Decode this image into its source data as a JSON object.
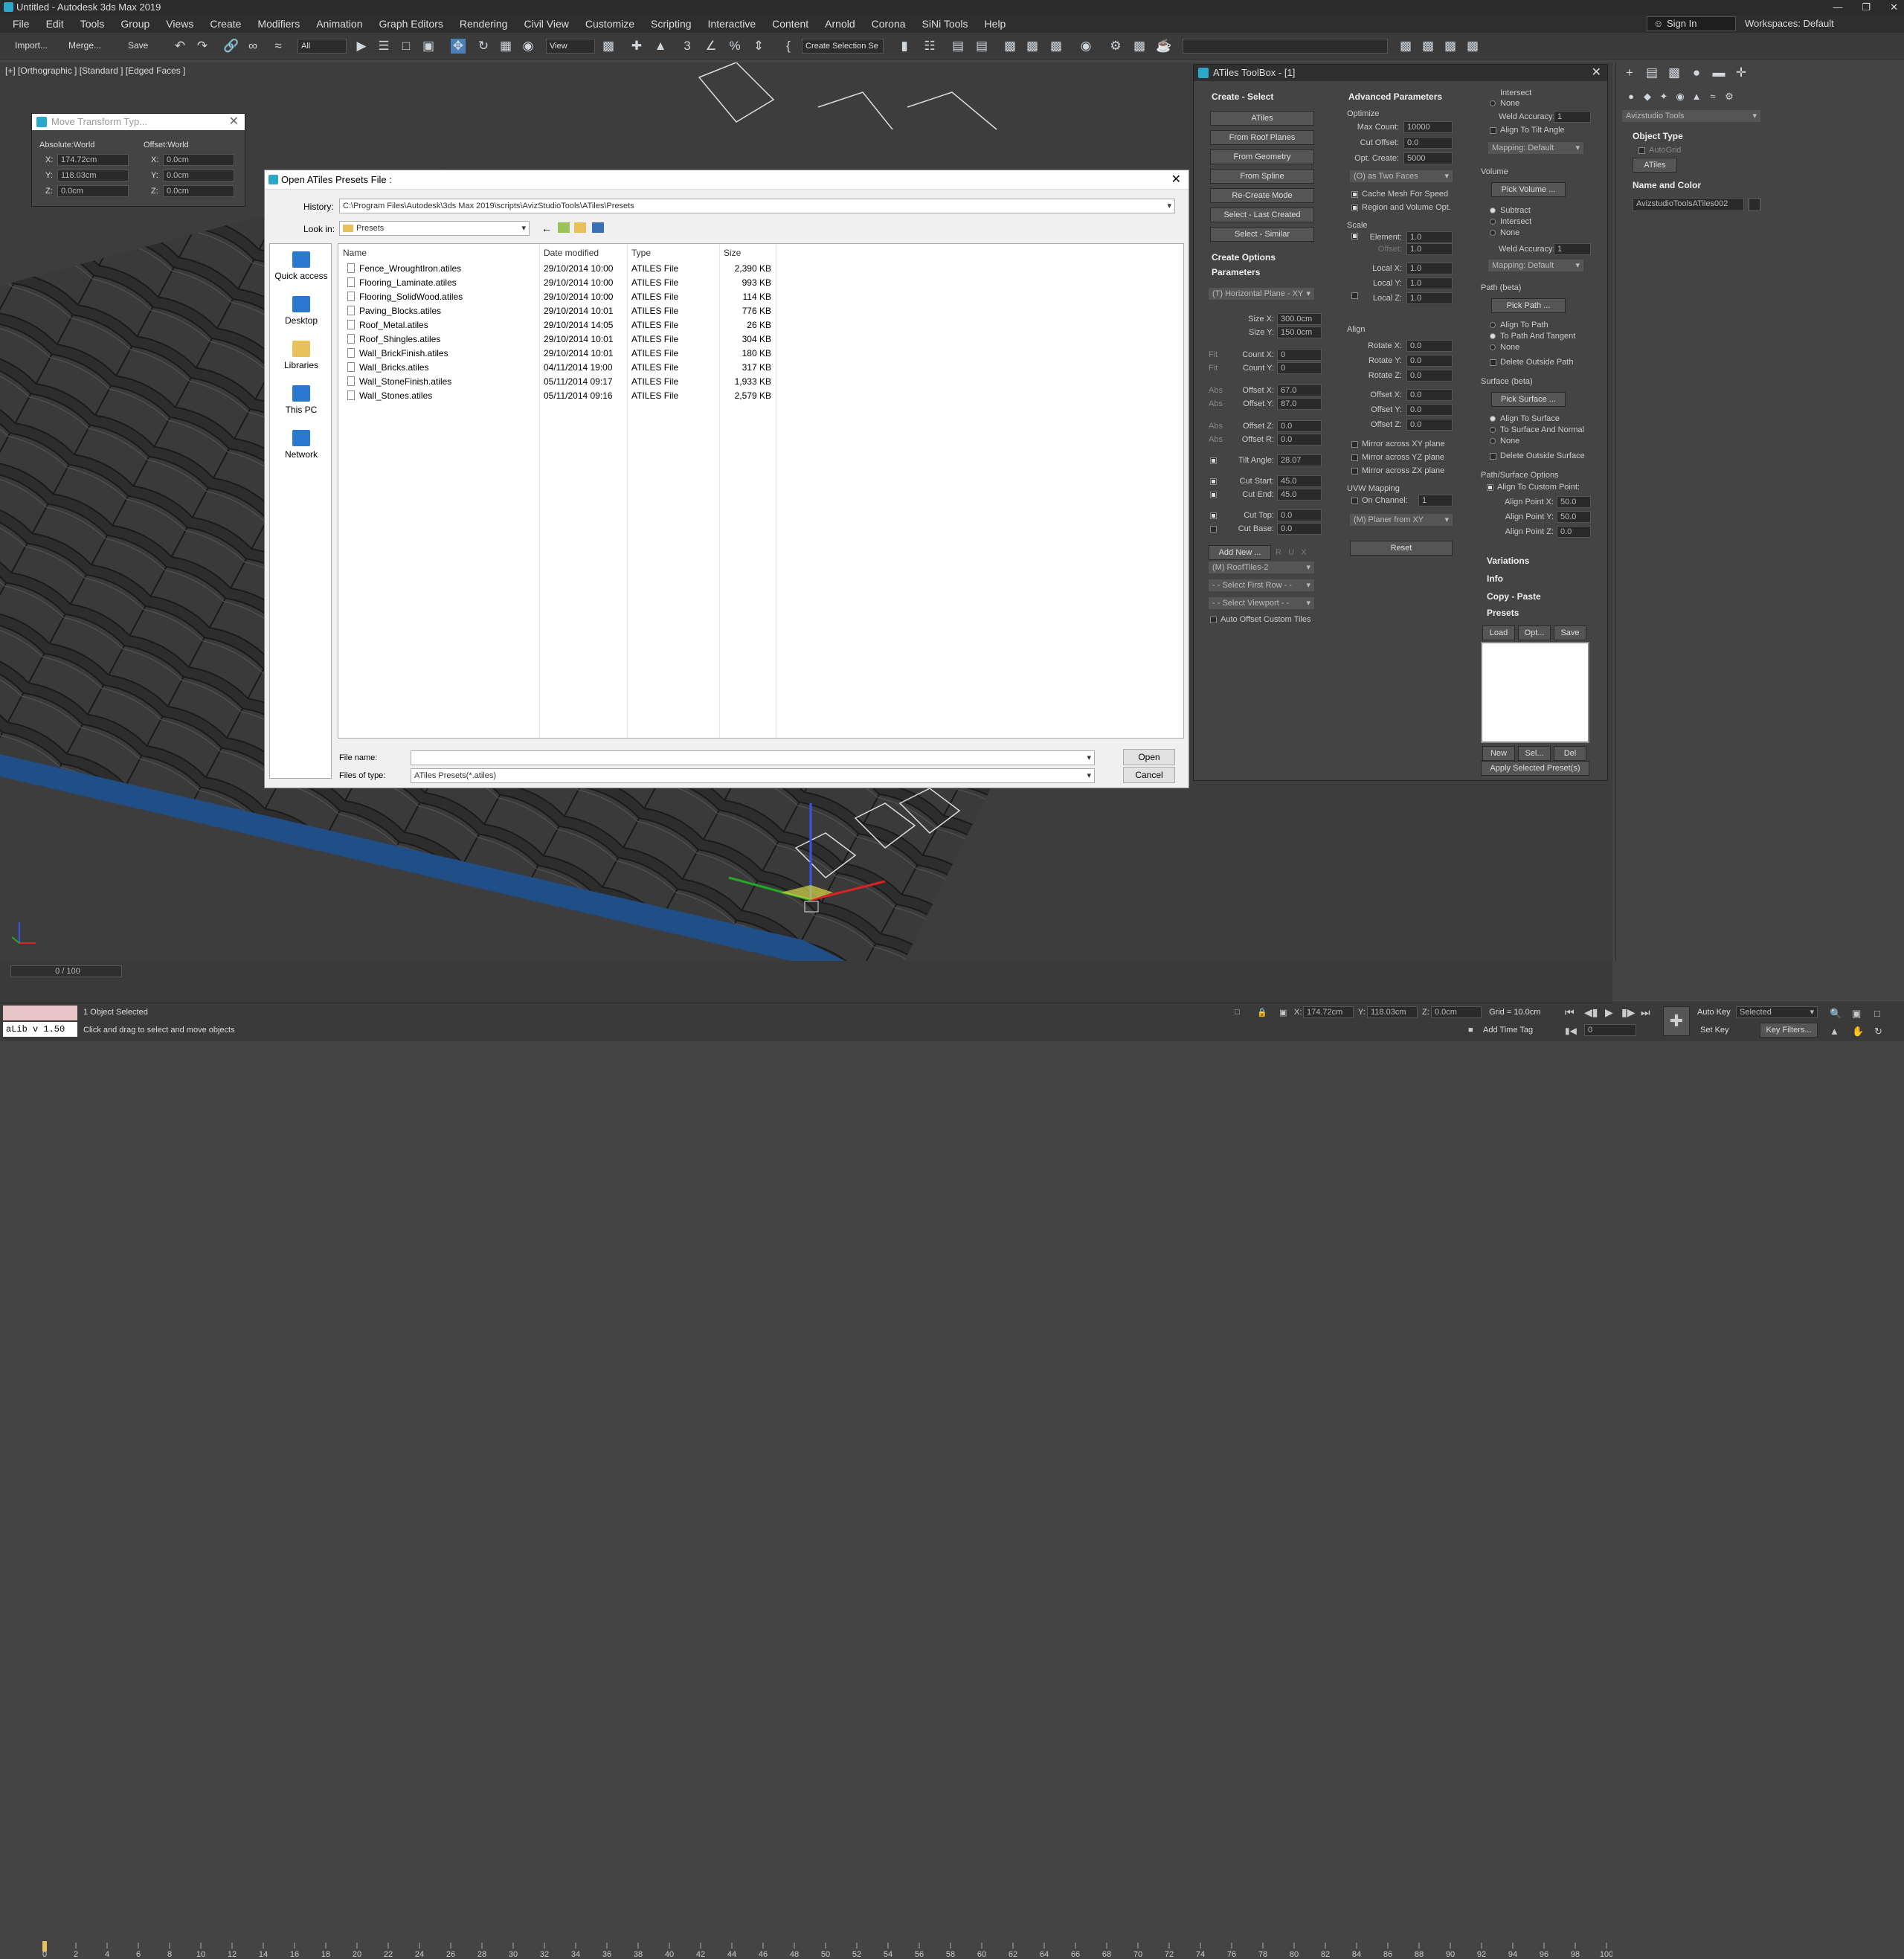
{
  "app": {
    "title": "Untitled - Autodesk 3ds Max 2019",
    "menus": [
      "File",
      "Edit",
      "Tools",
      "Group",
      "Views",
      "Create",
      "Modifiers",
      "Animation",
      "Graph Editors",
      "Rendering",
      "Civil View",
      "Customize",
      "Scripting",
      "Interactive",
      "Content",
      "Arnold",
      "Corona",
      "SiNi Tools",
      "Help"
    ],
    "sign_in": "Sign In",
    "workspaces": "Workspaces: Default"
  },
  "toolbar": {
    "import": "Import...",
    "merge": "Merge...",
    "save": "Save",
    "selection_filter": "All",
    "ref_coord": "View",
    "create_selection_set": "Create Selection Se"
  },
  "viewport": {
    "label": "[+] [Orthographic ] [Standard ] [Edged Faces ]"
  },
  "move_transform": {
    "title": "Move Transform Typ...",
    "absolute_label": "Absolute:World",
    "offset_label": "Offset:World",
    "abs": [
      {
        "axis": "X:",
        "value": "174.72cm"
      },
      {
        "axis": "Y:",
        "value": "118.03cm"
      },
      {
        "axis": "Z:",
        "value": "0.0cm"
      }
    ],
    "off": [
      {
        "axis": "X:",
        "value": "0.0cm"
      },
      {
        "axis": "Y:",
        "value": "0.0cm"
      },
      {
        "axis": "Z:",
        "value": "0.0cm"
      }
    ]
  },
  "dialog": {
    "title": "Open ATiles Presets File :",
    "history_label": "History:",
    "history_value": "C:\\Program Files\\Autodesk\\3ds Max 2019\\scripts\\AvizStudioTools\\ATiles\\Presets",
    "lookin_label": "Look in:",
    "lookin_value": "Presets",
    "places": [
      "Quick access",
      "Desktop",
      "Libraries",
      "This PC",
      "Network"
    ],
    "headers": {
      "name": "Name",
      "date": "Date modified",
      "type": "Type",
      "size": "Size"
    },
    "files": [
      {
        "name": "Fence_WroughtIron.atiles",
        "date": "29/10/2014 10:00",
        "type": "ATILES File",
        "size": "2,390 KB"
      },
      {
        "name": "Flooring_Laminate.atiles",
        "date": "29/10/2014 10:00",
        "type": "ATILES File",
        "size": "993 KB"
      },
      {
        "name": "Flooring_SolidWood.atiles",
        "date": "29/10/2014 10:00",
        "type": "ATILES File",
        "size": "114 KB"
      },
      {
        "name": "Paving_Blocks.atiles",
        "date": "29/10/2014 10:01",
        "type": "ATILES File",
        "size": "776 KB"
      },
      {
        "name": "Roof_Metal.atiles",
        "date": "29/10/2014 14:05",
        "type": "ATILES File",
        "size": "26 KB"
      },
      {
        "name": "Roof_Shingles.atiles",
        "date": "29/10/2014 10:01",
        "type": "ATILES File",
        "size": "304 KB"
      },
      {
        "name": "Wall_BrickFinish.atiles",
        "date": "29/10/2014 10:01",
        "type": "ATILES File",
        "size": "180 KB"
      },
      {
        "name": "Wall_Bricks.atiles",
        "date": "04/11/2014 19:00",
        "type": "ATILES File",
        "size": "317 KB"
      },
      {
        "name": "Wall_StoneFinish.atiles",
        "date": "05/11/2014 09:17",
        "type": "ATILES File",
        "size": "1,933 KB"
      },
      {
        "name": "Wall_Stones.atiles",
        "date": "05/11/2014 09:16",
        "type": "ATILES File",
        "size": "2,579 KB"
      }
    ],
    "filename_label": "File name:",
    "filename_value": "",
    "filetype_label": "Files of type:",
    "filetype_value": "ATiles Presets(*.atiles)",
    "open": "Open",
    "cancel": "Cancel"
  },
  "toolbox": {
    "title": "ATiles ToolBox - [1]",
    "create_select": "Create - Select",
    "buttons": [
      "ATiles",
      "From Roof Planes",
      "From Geometry",
      "From Spline",
      "Re-Create Mode",
      "Select - Last Created",
      "Select - Similar"
    ],
    "create_options": "Create Options",
    "parameters": "Parameters",
    "plane": "(T) Horizontal Plane - XY",
    "params": [
      {
        "pre": "",
        "label": "Size X:",
        "value": "300.0cm"
      },
      {
        "pre": "",
        "label": "Size Y:",
        "value": "150.0cm"
      },
      {
        "pre": "Fit",
        "label": "Count X:",
        "value": "0"
      },
      {
        "pre": "Fit",
        "label": "Count Y:",
        "value": "0"
      },
      {
        "pre": "Abs",
        "label": "Offset X:",
        "value": "67.0"
      },
      {
        "pre": "Abs",
        "label": "Offset Y:",
        "value": "87.0"
      },
      {
        "pre": "Abs",
        "label": "Offset Z:",
        "value": "0.0"
      },
      {
        "pre": "Abs",
        "label": "Offset R:",
        "value": "0.0"
      },
      {
        "pre": "",
        "label": "Tilt Angle:",
        "value": "28.07"
      },
      {
        "pre": "",
        "label": "Cut Start:",
        "value": "45.0"
      },
      {
        "pre": "",
        "label": "Cut End:",
        "value": "45.0"
      },
      {
        "pre": "",
        "label": "Cut Top:",
        "value": "0.0"
      },
      {
        "pre": "",
        "label": "Cut Base:",
        "value": "0.0"
      }
    ],
    "add_new": "Add New ...",
    "roof_tiles": "(M) RoofTiles-2",
    "select_first_row": "- - Select First Row - -",
    "select_viewport": "- - Select Viewport - -",
    "auto_offset": "Auto Offset Custom Tiles",
    "advanced": "Advanced Parameters",
    "optimize": "Optimize",
    "adv": [
      {
        "label": "Max Count:",
        "value": "10000"
      },
      {
        "label": "Cut Offset:",
        "value": "0.0"
      },
      {
        "label": "Opt. Create:",
        "value": "5000"
      }
    ],
    "two_faces": "(O) as Two Faces",
    "cache_mesh": "Cache Mesh For Speed",
    "region_volume": "Region and Volume Opt.",
    "scale": "Scale",
    "element": {
      "label": "Element:",
      "value": "1.0"
    },
    "offset": {
      "label": "Offset:",
      "value": "1.0"
    },
    "local": [
      {
        "label": "Local X:",
        "value": "1.0"
      },
      {
        "label": "Local Y:",
        "value": "1.0"
      },
      {
        "label": "Local Z:",
        "value": "1.0"
      }
    ],
    "align": "Align",
    "rotate": [
      {
        "label": "Rotate X:",
        "value": "0.0"
      },
      {
        "label": "Rotate Y:",
        "value": "0.0"
      },
      {
        "label": "Rotate Z:",
        "value": "0.0"
      }
    ],
    "aoffset": [
      {
        "label": "Offset X:",
        "value": "0.0"
      },
      {
        "label": "Offset Y:",
        "value": "0.0"
      },
      {
        "label": "Offset Z:",
        "value": "0.0"
      }
    ],
    "mirror": [
      "Mirror across XY plane",
      "Mirror across YZ plane",
      "Mirror across ZX plane"
    ],
    "uvw": "UVW Mapping",
    "on_channel": {
      "label": "On Channel:",
      "value": "1"
    },
    "planer": "(M) Planer from XY",
    "reset": "Reset",
    "c3_top": [
      "Intersect",
      "None"
    ],
    "weld_acc": {
      "label": "Weld Accuracy:",
      "value": "1"
    },
    "align_tilt": "Align To Tilt Angle",
    "mapping_default": "Mapping: Default",
    "volume": "Volume",
    "pick_volume": "Pick Volume ...",
    "vol_opts": [
      "Subtract",
      "Intersect",
      "None"
    ],
    "path": "Path (beta)",
    "pick_path": "Pick Path ...",
    "path_opts": [
      "Align To Path",
      "To Path And Tangent",
      "None"
    ],
    "delete_outside_path": "Delete Outside Path",
    "surface": "Surface (beta)",
    "pick_surface": "Pick Surface ...",
    "surf_opts": [
      "Align To Surface",
      "To Surface And Normal",
      "None"
    ],
    "delete_outside_surface": "Delete Outside Surface",
    "path_surface_opts": "Path/Surface Options",
    "align_custom": "Align To Custom Point:",
    "align_points": [
      {
        "label": "Align Point X:",
        "value": "50.0"
      },
      {
        "label": "Align Point Y:",
        "value": "50.0"
      },
      {
        "label": "Align Point Z:",
        "value": "0.0"
      }
    ],
    "variations": "Variations",
    "info": "Info",
    "copy_paste": "Copy - Paste",
    "presets": "Presets",
    "load": "Load",
    "opt": "Opt...",
    "save": "Save",
    "new": "New",
    "sel": "Sel...",
    "del": "Del",
    "apply": "Apply Selected Preset(s)"
  },
  "command_panel": {
    "category": "Avizstudio Tools",
    "object_type": "Object Type",
    "autogrid": "AutoGrid",
    "atiles": "ATiles",
    "name_color": "Name and Color",
    "object_name": "AvizstudioToolsATiles002"
  },
  "timeline": {
    "frame": "0 / 100",
    "ticks": [
      "0",
      "2",
      "4",
      "6",
      "8",
      "10",
      "12",
      "14",
      "16",
      "18",
      "20",
      "22",
      "24",
      "26",
      "28",
      "30",
      "32",
      "34",
      "36",
      "38",
      "40",
      "42",
      "44",
      "46",
      "48",
      "50",
      "52",
      "54",
      "56",
      "58",
      "60",
      "62",
      "64",
      "66",
      "68",
      "70",
      "72",
      "74",
      "76",
      "78",
      "80",
      "82",
      "84",
      "86",
      "88",
      "90",
      "92",
      "94",
      "96",
      "98",
      "100"
    ]
  },
  "status": {
    "script": "aLib v 1.50",
    "selected": "1 Object Selected",
    "hint": "Click and drag to select and move objects",
    "x": "174.72cm",
    "y": "118.03cm",
    "z": "0.0cm",
    "grid": "Grid = 10.0cm",
    "add_time_tag": "Add Time Tag",
    "auto_key": "Auto Key",
    "selected_dd": "Selected",
    "set_key": "Set Key",
    "key_filters": "Key Filters...",
    "frame_field": "0"
  }
}
